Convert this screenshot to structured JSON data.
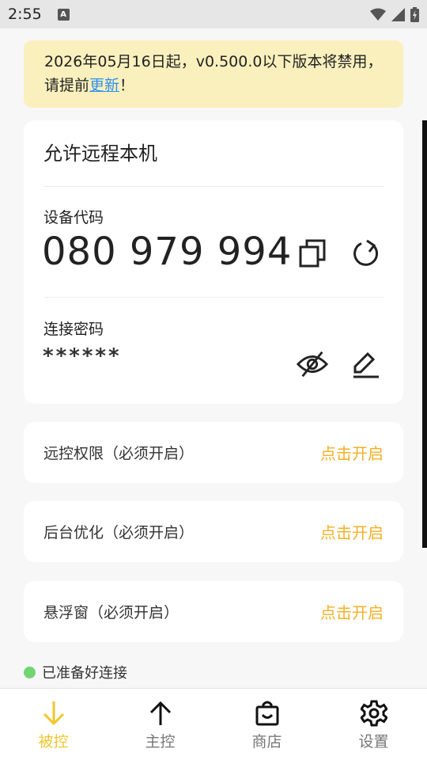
{
  "status_bar": {
    "time": "2:55",
    "badge": "A"
  },
  "banner": {
    "text_before": "2026年05月16日起，v0.500.0以下版本将禁用，请提前",
    "link": "更新",
    "text_after": "！"
  },
  "remote_card": {
    "title": "允许远程本机",
    "device_code_label": "设备代码",
    "device_code": "080 979 994",
    "password_label": "连接密码",
    "password_mask": "******"
  },
  "permissions": [
    {
      "label": "远控权限（必须开启）",
      "action": "点击开启"
    },
    {
      "label": "后台优化（必须开启）",
      "action": "点击开启"
    },
    {
      "label": "悬浮窗（必须开启）",
      "action": "点击开启"
    }
  ],
  "status": {
    "text": "已准备好连接",
    "color": "#72d572"
  },
  "tabs": [
    {
      "label": "被控",
      "icon": "arrow-down-icon",
      "active": true
    },
    {
      "label": "主控",
      "icon": "arrow-up-icon",
      "active": false
    },
    {
      "label": "商店",
      "icon": "shopping-bag-icon",
      "active": false
    },
    {
      "label": "设置",
      "icon": "gear-icon",
      "active": false
    }
  ],
  "colors": {
    "accent": "#f3c630",
    "action": "#f5b024",
    "banner_bg": "#faf0bd",
    "link": "#2f8ff0"
  }
}
